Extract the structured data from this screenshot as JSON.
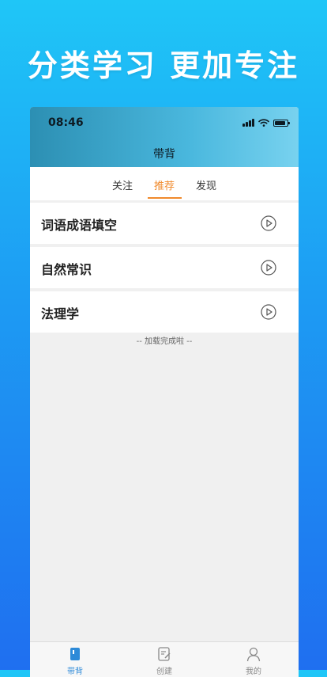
{
  "promo": {
    "headline": "分类学习 更加专注"
  },
  "status_bar": {
    "time": "08:46"
  },
  "nav": {
    "title": "带背"
  },
  "tabs": [
    {
      "label": "关注",
      "active": false
    },
    {
      "label": "推荐",
      "active": true
    },
    {
      "label": "发现",
      "active": false
    }
  ],
  "list": [
    {
      "label": "词语成语填空",
      "icon": "play-circle-icon"
    },
    {
      "label": "自然常识",
      "icon": "play-circle-icon"
    },
    {
      "label": "法理学",
      "icon": "play-circle-icon"
    }
  ],
  "loaded_text": "-- 加载完成啦 --",
  "tabbar": [
    {
      "label": "带背",
      "icon": "book-icon",
      "active": true
    },
    {
      "label": "创建",
      "icon": "edit-icon",
      "active": false
    },
    {
      "label": "我的",
      "icon": "user-icon",
      "active": false
    }
  ],
  "colors": {
    "accent": "#f08a2c",
    "tabbar_active": "#2d8ad8",
    "header_start": "#2c8fb3",
    "header_end": "#78d2ef"
  }
}
